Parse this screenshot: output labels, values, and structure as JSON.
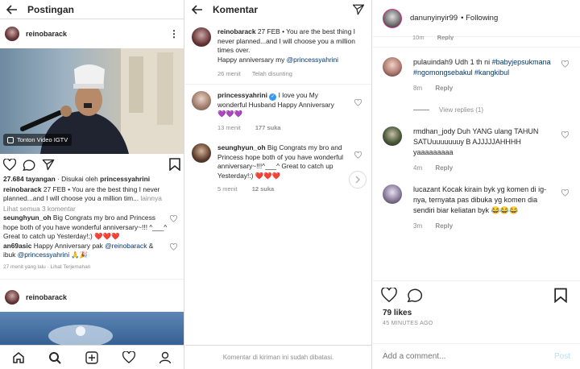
{
  "posts": {
    "header_title": "Postingan",
    "post1": {
      "username": "reinobarack",
      "more": "⋮",
      "igtv_label": "Tonton Video IGTV",
      "views": "27.684 tayangan",
      "liked_by_prefix": "· Disukai oleh",
      "liked_by_user": "princessyahrini",
      "caption_user": "reinobarack",
      "caption_text": "27 FEB • You are the best thing I never planned...and I will choose you a million tim...",
      "caption_more": "lainnya",
      "view_all_comments": "Lihat semua 3 komentar",
      "comments": [
        {
          "user": "seunghyun_oh",
          "text": "Big Congrats my bro and Princess hope both of you have wonderful anniversary~!!! ^___^ Great to catch up Yesterday!;) ❤️❤️❤️"
        },
        {
          "user": "an69asic",
          "text": "Happy Anniversary pak ",
          "mention1": "@reinobarack",
          "mid": " & ibuk ",
          "mention2": "@princessyahrini",
          "emoji": " 🙏🎉"
        }
      ],
      "time_ago": "27 menit yang lalu",
      "translate": "· Lihat Terjemahan"
    },
    "post2": {
      "username": "reinobarack"
    },
    "bottom_nav": [
      "home-icon",
      "search-icon",
      "add-icon",
      "heart-icon",
      "profile-icon"
    ]
  },
  "comments_screen": {
    "header_title": "Komentar",
    "items": [
      {
        "user": "reinobarack",
        "text": "27 FEB • You are the best thing I never planned...and I will choose you a million times over.",
        "text2": "Happy anniversary my ",
        "mention": "@princessyahrini",
        "time": "26 menit",
        "extra": "Telah disunting",
        "likes": ""
      },
      {
        "user": "princessyahrini",
        "verified": "✓",
        "text": "I love you My wonderful Husband Happy Anniversary",
        "emoji": "💜💜💜",
        "time": "13 menit",
        "extra": "",
        "likes": "177 suka"
      },
      {
        "user": "seunghyun_oh",
        "text": "Big Congrats my bro and Princess hope both of you have wonderful anniversary~!!!^___^ Great to catch up Yesterday!:) ❤️❤️❤️",
        "time": "5 menit",
        "extra": "",
        "likes": "12 suka"
      }
    ],
    "disabled_note": "Komentar di kiriman ini sudah dibatasi."
  },
  "detail": {
    "username": "danunyinyir99",
    "following": "• Following",
    "top_time": "10m",
    "top_reply": "Reply",
    "comments": [
      {
        "user": "pulauindah9",
        "text": "Udh 1 th ni",
        "tags": "#babyjepsukmana #ngomongsebakul #kangkibul",
        "time": "8m",
        "reply": "Reply",
        "view_replies": "View replies (1)"
      },
      {
        "user": "rmdhan_jody",
        "text": "Duh YANG ulang TAHUN SATUuuuuuuuy B AJJJJJAHHHH yaaaaaaaaa",
        "time": "4m",
        "reply": "Reply"
      },
      {
        "user": "lucazant",
        "text": "Kocak kirain byk yg komen di ig-nya, ternyata pas dibuka yg komen dia sendiri biar keliatan byk 😂😂😂",
        "time": "3m",
        "reply": "Reply"
      }
    ],
    "likes": "79 likes",
    "posted_ago": "45 MINUTES AGO",
    "add_comment_placeholder": "Add a comment...",
    "post_button": "Post"
  }
}
